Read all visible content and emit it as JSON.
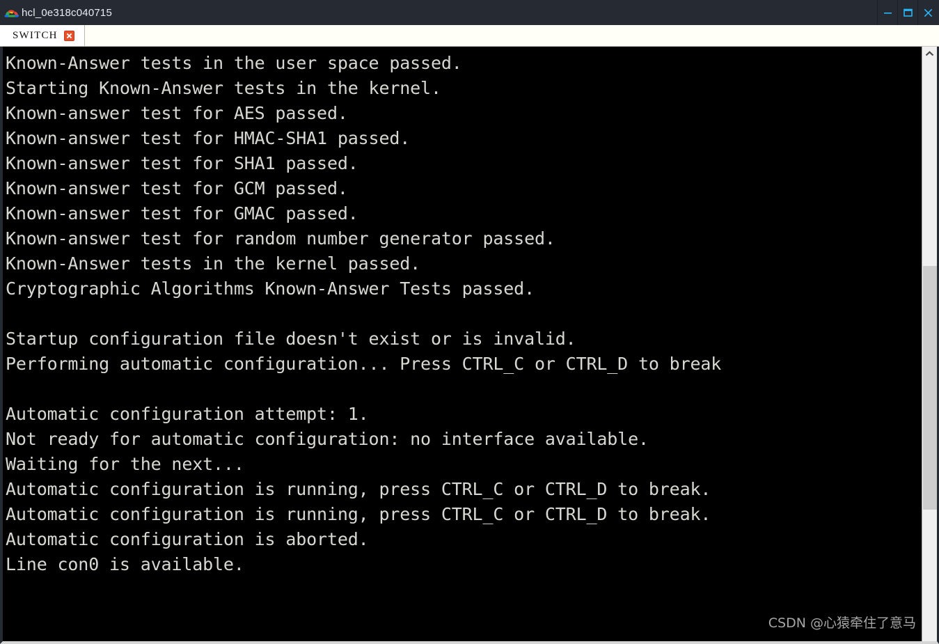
{
  "window": {
    "title": "hcl_0e318c040715",
    "app_icon": "cloud-icon",
    "controls": {
      "minimize": "minimize-icon",
      "maximize": "maximize-icon",
      "close": "close-icon"
    }
  },
  "tabs": [
    {
      "label": "SWITCH",
      "close": "tab-close-icon",
      "active": true
    }
  ],
  "terminal": {
    "lines": [
      "Known-Answer tests in the user space passed.",
      "Starting Known-Answer tests in the kernel.",
      "Known-answer test for AES passed.",
      "Known-answer test for HMAC-SHA1 passed.",
      "Known-answer test for SHA1 passed.",
      "Known-answer test for GCM passed.",
      "Known-answer test for GMAC passed.",
      "Known-answer test for random number generator passed.",
      "Known-Answer tests in the kernel passed.",
      "Cryptographic Algorithms Known-Answer Tests passed.",
      "",
      "Startup configuration file doesn't exist or is invalid.",
      "Performing automatic configuration... Press CTRL_C or CTRL_D to break",
      "",
      "Automatic configuration attempt: 1.",
      "Not ready for automatic configuration: no interface available.",
      "Waiting for the next...",
      "Automatic configuration is running, press CTRL_C or CTRL_D to break.",
      "Automatic configuration is running, press CTRL_C or CTRL_D to break.",
      "Automatic configuration is aborted.",
      "Line con0 is available."
    ]
  },
  "scrollbar": {
    "up_arrow": "chevron-up-icon"
  },
  "watermark": {
    "text": "CSDN @心猿牵住了意马"
  },
  "colors": {
    "titlebar_bg": "#252a33",
    "titlebar_text": "#e9ecf1",
    "control_accent": "#29b6f6",
    "tab_bg": "#ffffff",
    "tab_strip_bg": "#fffff7",
    "tab_close_bg": "#e8502a",
    "terminal_bg": "#000000",
    "terminal_text": "#d8d8d2",
    "scrollbar_track": "#f0f0f0",
    "scrollbar_thumb": "#cdcdcd",
    "watermark_text": "#a6a6a6"
  }
}
